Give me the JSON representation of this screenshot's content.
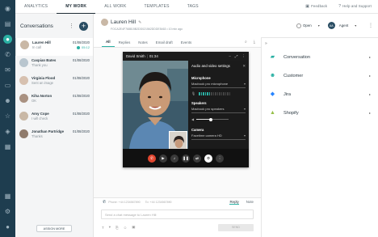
{
  "nav": {
    "tabs": [
      "ANALYTICS",
      "MY WORK",
      "ALL WORK",
      "TEMPLATES",
      "TAGS"
    ],
    "active_tab": "MY WORK",
    "feedback": "Feedback",
    "help": "Help and Support"
  },
  "conversations": {
    "title": "Conversations",
    "items": [
      {
        "name": "Lauren Hill",
        "sub": "In call",
        "date": "01/08/2020",
        "timer": "05:12"
      },
      {
        "name": "Caspian Bates",
        "sub": "Thank you",
        "date": "01/08/2020"
      },
      {
        "name": "Virginia Flood",
        "sub": "Sent an image",
        "date": "01/08/2020"
      },
      {
        "name": "Kiha Norton",
        "sub": "OK",
        "date": "01/08/2020"
      },
      {
        "name": "Amy Cope",
        "sub": "I will check",
        "date": "01/08/2020"
      },
      {
        "name": "Jonathan Partridge",
        "sub": "Thanks",
        "date": "01/08/2020"
      }
    ],
    "assign_more": "ASSIGN MORE"
  },
  "main": {
    "contact_name": "Lauren Hill",
    "meta": "FOCA2E4F768815B2DD021562DDDE5463  •  10 min ago",
    "tabs": [
      "All",
      "Replies",
      "Notes",
      "Email draft",
      "Events"
    ],
    "active_tab": "All"
  },
  "video": {
    "caller": "David Smith",
    "duration": "01:34",
    "settings_title": "Audio and video settings",
    "mic_label": "Microphone",
    "mic_value": "Macbook pro microphone",
    "mic_level": 0.4,
    "speakers_label": "Speakers",
    "speakers_value": "Macbook pro speakers",
    "volume": 0.45,
    "camera_label": "Camera",
    "camera_value": "Facetime camera HD"
  },
  "composer": {
    "from_number": "Phone: +44 1234567890",
    "to_number": "To: +44 1234567890",
    "reply_tab": "Reply",
    "note_tab": "Note",
    "placeholder": "Send a chat message to Lauren Hill",
    "send_label": "SEND"
  },
  "status": {
    "state": "Open",
    "agent": "Agent",
    "agent_initials": "AA"
  },
  "apps": {
    "items": [
      {
        "name": "Conversation",
        "icon": "chat-icon",
        "color": "#2ab0a3"
      },
      {
        "name": "Customer",
        "icon": "people-icon",
        "color": "#2ab0a3"
      },
      {
        "name": "Jira",
        "icon": "jira-icon",
        "color": "#2684ff"
      },
      {
        "name": "Shopify",
        "icon": "shopify-icon",
        "color": "#95bf47"
      }
    ]
  },
  "colors": {
    "accent": "#2ab0a3",
    "rail": "#1e3d4f",
    "end_call": "#e2462f"
  }
}
